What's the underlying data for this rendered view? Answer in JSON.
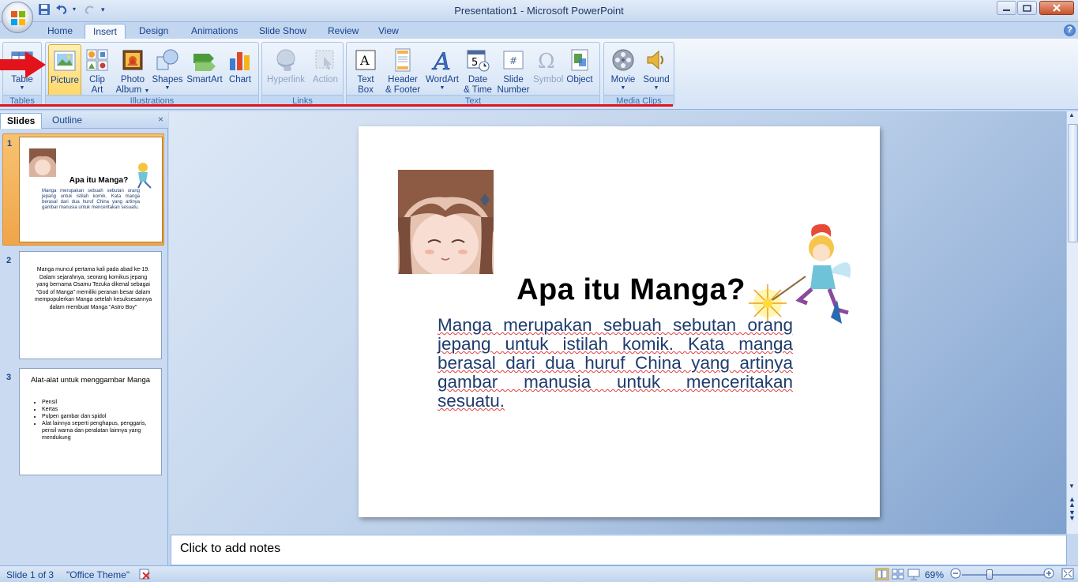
{
  "window": {
    "title": "Presentation1 - Microsoft PowerPoint"
  },
  "tabs": [
    "Home",
    "Insert",
    "Design",
    "Animations",
    "Slide Show",
    "Review",
    "View"
  ],
  "active_tab": "Insert",
  "ribbon": {
    "groups": {
      "tables": "Tables",
      "illustrations": "Illustrations",
      "links": "Links",
      "text": "Text",
      "media": "Media Clips"
    },
    "buttons": {
      "table": "Table",
      "picture": "Picture",
      "clip_art_1": "Clip",
      "clip_art_2": "Art",
      "photo_album_1": "Photo",
      "photo_album_2": "Album",
      "shapes": "Shapes",
      "smartart": "SmartArt",
      "chart": "Chart",
      "hyperlink": "Hyperlink",
      "action": "Action",
      "text_box_1": "Text",
      "text_box_2": "Box",
      "header_footer_1": "Header",
      "header_footer_2": "& Footer",
      "wordart": "WordArt",
      "date_time_1": "Date",
      "date_time_2": "& Time",
      "slide_number_1": "Slide",
      "slide_number_2": "Number",
      "symbol": "Symbol",
      "object": "Object",
      "movie": "Movie",
      "sound": "Sound"
    }
  },
  "pane": {
    "tab_slides": "Slides",
    "tab_outline": "Outline",
    "close": "×"
  },
  "thumbnails": [
    {
      "number": "1",
      "title": "Apa itu Manga?",
      "body": "Manga merupakan sebuah sebutan orang jepang untuk istilah komik. Kata manga berasal dari dua huruf China yang artinya gambar manusia untuk menceritakan sesuatu."
    },
    {
      "number": "2",
      "body": "Manga muncul pertama kali pada abad ke-19. Dalam sejarahnya, seorang komikus jepang yang bernama Osamu Tezuka dikenal sebagai \"God of Manga\" memiliki peranan besar dalam mempopulerkan Manga setelah kesuksesannya dalam membuat Manga \"Astro Boy\""
    },
    {
      "number": "3",
      "title": "Alat-alat untuk menggambar Manga",
      "bullets": [
        "Pensil",
        "Kertas",
        "Pulpen gambar dan spidol",
        "Alat lainnya seperti penghapus, penggaris, pensil warna dan peralatan lainnya yang mendukung"
      ]
    }
  ],
  "slide": {
    "title": "Apa itu Manga?",
    "body": "Manga merupakan sebuah sebutan orang jepang untuk istilah komik. Kata manga berasal dari dua huruf China yang artinya gambar manusia untuk menceritakan sesuatu."
  },
  "notes_placeholder": "Click to add notes",
  "status": {
    "slide_of": "Slide 1 of 3",
    "theme": "\"Office Theme\"",
    "zoom": "69%",
    "zoom_level": 0.69
  },
  "colors": {
    "accent": "#15428b",
    "annotation_red": "#e3131b",
    "selected_button": "#ffd76a"
  }
}
